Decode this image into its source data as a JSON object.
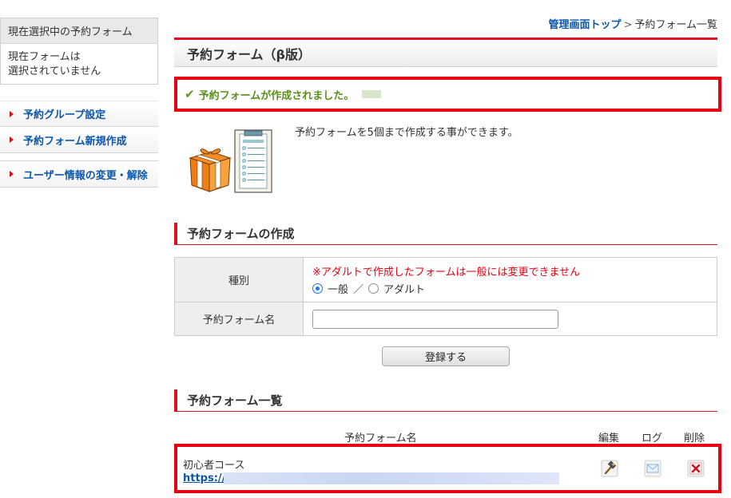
{
  "sidebar": {
    "current_heading": "現在選択中の予約フォーム",
    "current_line1": "現在フォームは",
    "current_line2": "選択されていません",
    "items": [
      {
        "label": "予約グループ設定"
      },
      {
        "label": "予約フォーム新規作成"
      },
      {
        "label": "ユーザー情報の変更・解除"
      }
    ]
  },
  "breadcrumb": {
    "home": "管理画面トップ",
    "separator": ">",
    "current": "予約フォーム一覧"
  },
  "page": {
    "title": "予約フォーム（β版）"
  },
  "message": {
    "text": "予約フォームが作成されました。",
    "color": "#5b8f1c"
  },
  "intro": {
    "text": "予約フォームを5個まで作成する事ができます。"
  },
  "create_section": {
    "heading": "予約フォームの作成",
    "type_label": "種別",
    "warning": "※アダルトで作成したフォームは一般には変更できません",
    "option_general": "一般",
    "option_sep": "／",
    "option_adult": "アダルト",
    "selected": "一般",
    "name_label": "予約フォーム名",
    "name_value": "",
    "submit_label": "登録する"
  },
  "list_section": {
    "heading": "予約フォーム一覧",
    "columns": {
      "name": "予約フォーム名",
      "edit": "編集",
      "log": "ログ",
      "delete": "削除"
    },
    "rows": [
      {
        "name": "初心者コース",
        "url_prefix": "https://"
      }
    ]
  },
  "colors": {
    "accent_red": "#e01020",
    "highlight_red": "#e60012",
    "link_blue": "#0a56a8",
    "success_green": "#5b8f1c"
  },
  "icons": {
    "message": "check-icon",
    "intro": "gift-clipboard-icon",
    "edit": "hammer-icon",
    "log": "mail-icon",
    "delete": "delete-x-icon"
  }
}
